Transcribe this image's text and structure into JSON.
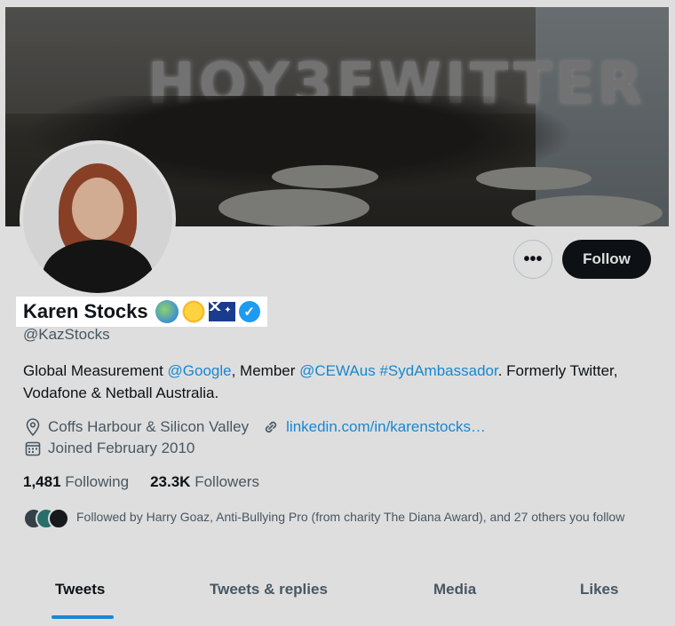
{
  "profile": {
    "name": "Karen Stocks",
    "emojis": [
      "globe-emoji",
      "sun-emoji",
      "australia-flag-emoji"
    ],
    "handle": "@KazStocks",
    "bio": {
      "part1": "Global Measurement ",
      "link1": "@Google",
      "part2": ", Member ",
      "link2": "@CEWAus",
      "part3": " ",
      "link3": "#SydAmbassador",
      "part4": ". Formerly Twitter, Vodafone & Netball Australia."
    },
    "location": "Coffs Harbour & Silicon Valley",
    "website": "linkedin.com/in/karenstocks…",
    "joined": "Joined February 2010",
    "following_count": "1,481",
    "following_label": "Following",
    "followers_count": "23.3K",
    "followers_label": "Followers",
    "followed_by": "Followed by Harry Goaz, Anti-Bullying Pro (from charity The Diana Award), and 27 others you follow"
  },
  "banner": {
    "balloon_text": "HOY3FWITTER"
  },
  "actions": {
    "more": "•••",
    "follow": "Follow"
  },
  "tabs": [
    {
      "label": "Tweets",
      "active": true
    },
    {
      "label": "Tweets & replies",
      "active": false
    },
    {
      "label": "Media",
      "active": false
    },
    {
      "label": "Likes",
      "active": false
    }
  ],
  "colors": {
    "accent": "#1d9bf0",
    "text": "#0f1419",
    "secondary": "#536471"
  }
}
